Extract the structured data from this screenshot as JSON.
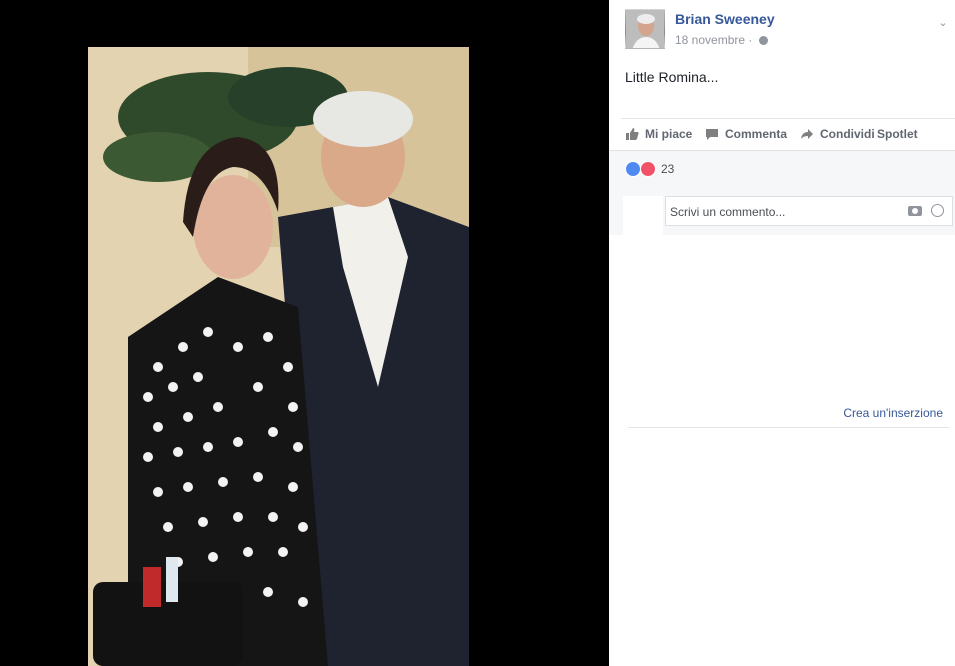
{
  "post": {
    "author": "Brian Sweeney",
    "date": "18 novembre",
    "separator": "·",
    "text": "Little Romina...",
    "actions": {
      "like": "Mi piace",
      "comment": "Commenta",
      "share": "Condividi",
      "extra": "Spotlet"
    },
    "reactions_count": "23",
    "comment_placeholder": "Scrivi un commento...",
    "create_ad": "Crea un'inserzione"
  },
  "colors": {
    "brand_link": "#365899",
    "like_blue": "#4f8af0",
    "love_red": "#f25268"
  }
}
